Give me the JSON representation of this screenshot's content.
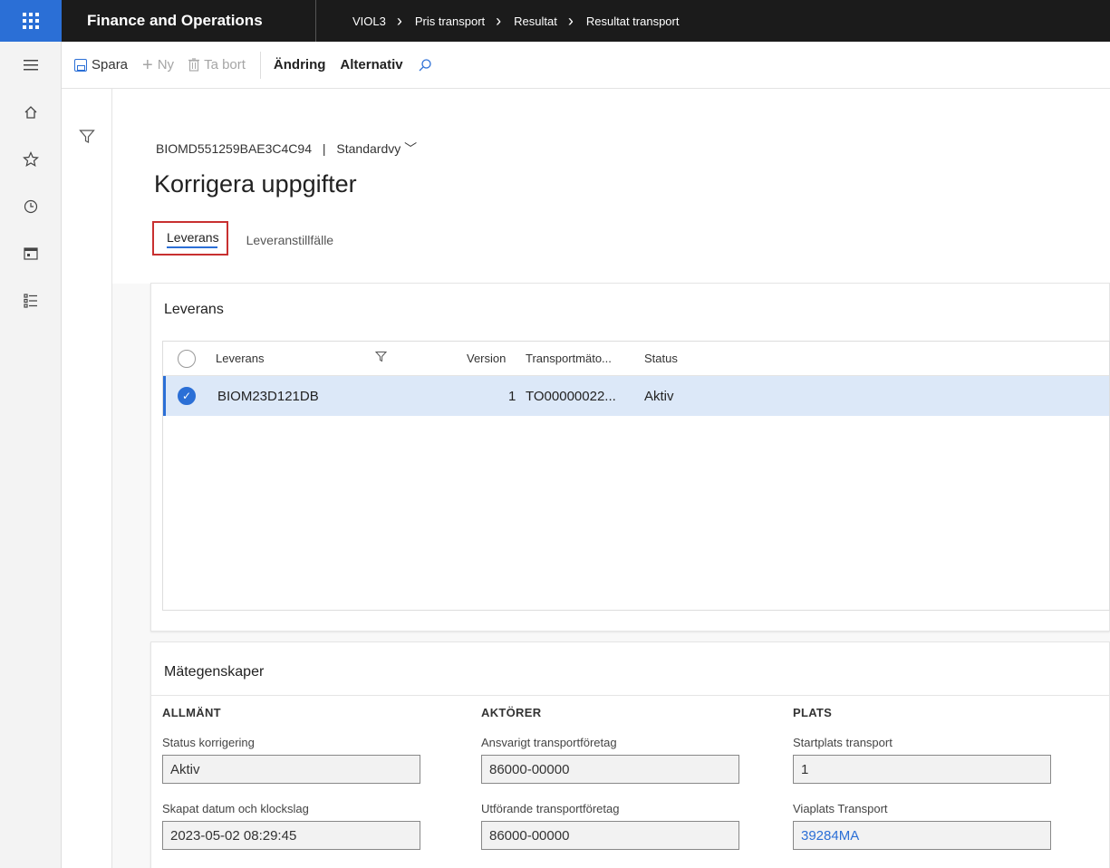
{
  "topbar": {
    "app_name": "Finance and Operations",
    "breadcrumbs": [
      "VIOL3",
      "Pris transport",
      "Resultat",
      "Resultat transport"
    ]
  },
  "rail": {
    "icons": [
      "hamburger-icon",
      "home-icon",
      "star-icon",
      "clock-icon",
      "workspace-icon",
      "list-icon"
    ]
  },
  "actions": {
    "save": "Spara",
    "new": "Ny",
    "delete": "Ta bort",
    "change": "Ändring",
    "options": "Alternativ"
  },
  "record": {
    "id": "BIOMD551259BAE3C4C94",
    "separator": "|",
    "view": "Standardvy"
  },
  "page_title": "Korrigera uppgifter",
  "tabs": [
    {
      "label": "Leverans",
      "active": true
    },
    {
      "label": "Leveranstillfälle",
      "active": false
    }
  ],
  "leverans_section": {
    "title": "Leverans",
    "columns": [
      "Leverans",
      "Version",
      "Transportmäto...",
      "Status"
    ],
    "rows": [
      {
        "leverans": "BIOM23D121DB",
        "version": "1",
        "transport": "TO00000022...",
        "status": "Aktiv",
        "selected": true
      }
    ]
  },
  "properties": {
    "title": "Mätegenskaper",
    "groups": [
      {
        "heading": "ALLMÄNT",
        "fields": [
          {
            "label": "Status korrigering",
            "value": "Aktiv"
          },
          {
            "label": "Skapat datum och klockslag",
            "value": "2023-05-02 08:29:45"
          }
        ]
      },
      {
        "heading": "AKTÖRER",
        "fields": [
          {
            "label": "Ansvarigt transportföretag",
            "value": "86000-00000"
          },
          {
            "label": "Utförande transportföretag",
            "value": "86000-00000"
          }
        ]
      },
      {
        "heading": "PLATS",
        "fields": [
          {
            "label": "Startplats transport",
            "value": "1"
          },
          {
            "label": "Viaplats Transport",
            "value": "39284MA"
          }
        ]
      }
    ]
  },
  "colors": {
    "accent": "#2b6fd6",
    "topbar": "#1b1b1b",
    "highlight": "#c83030",
    "row_selected": "#dce8f8"
  }
}
